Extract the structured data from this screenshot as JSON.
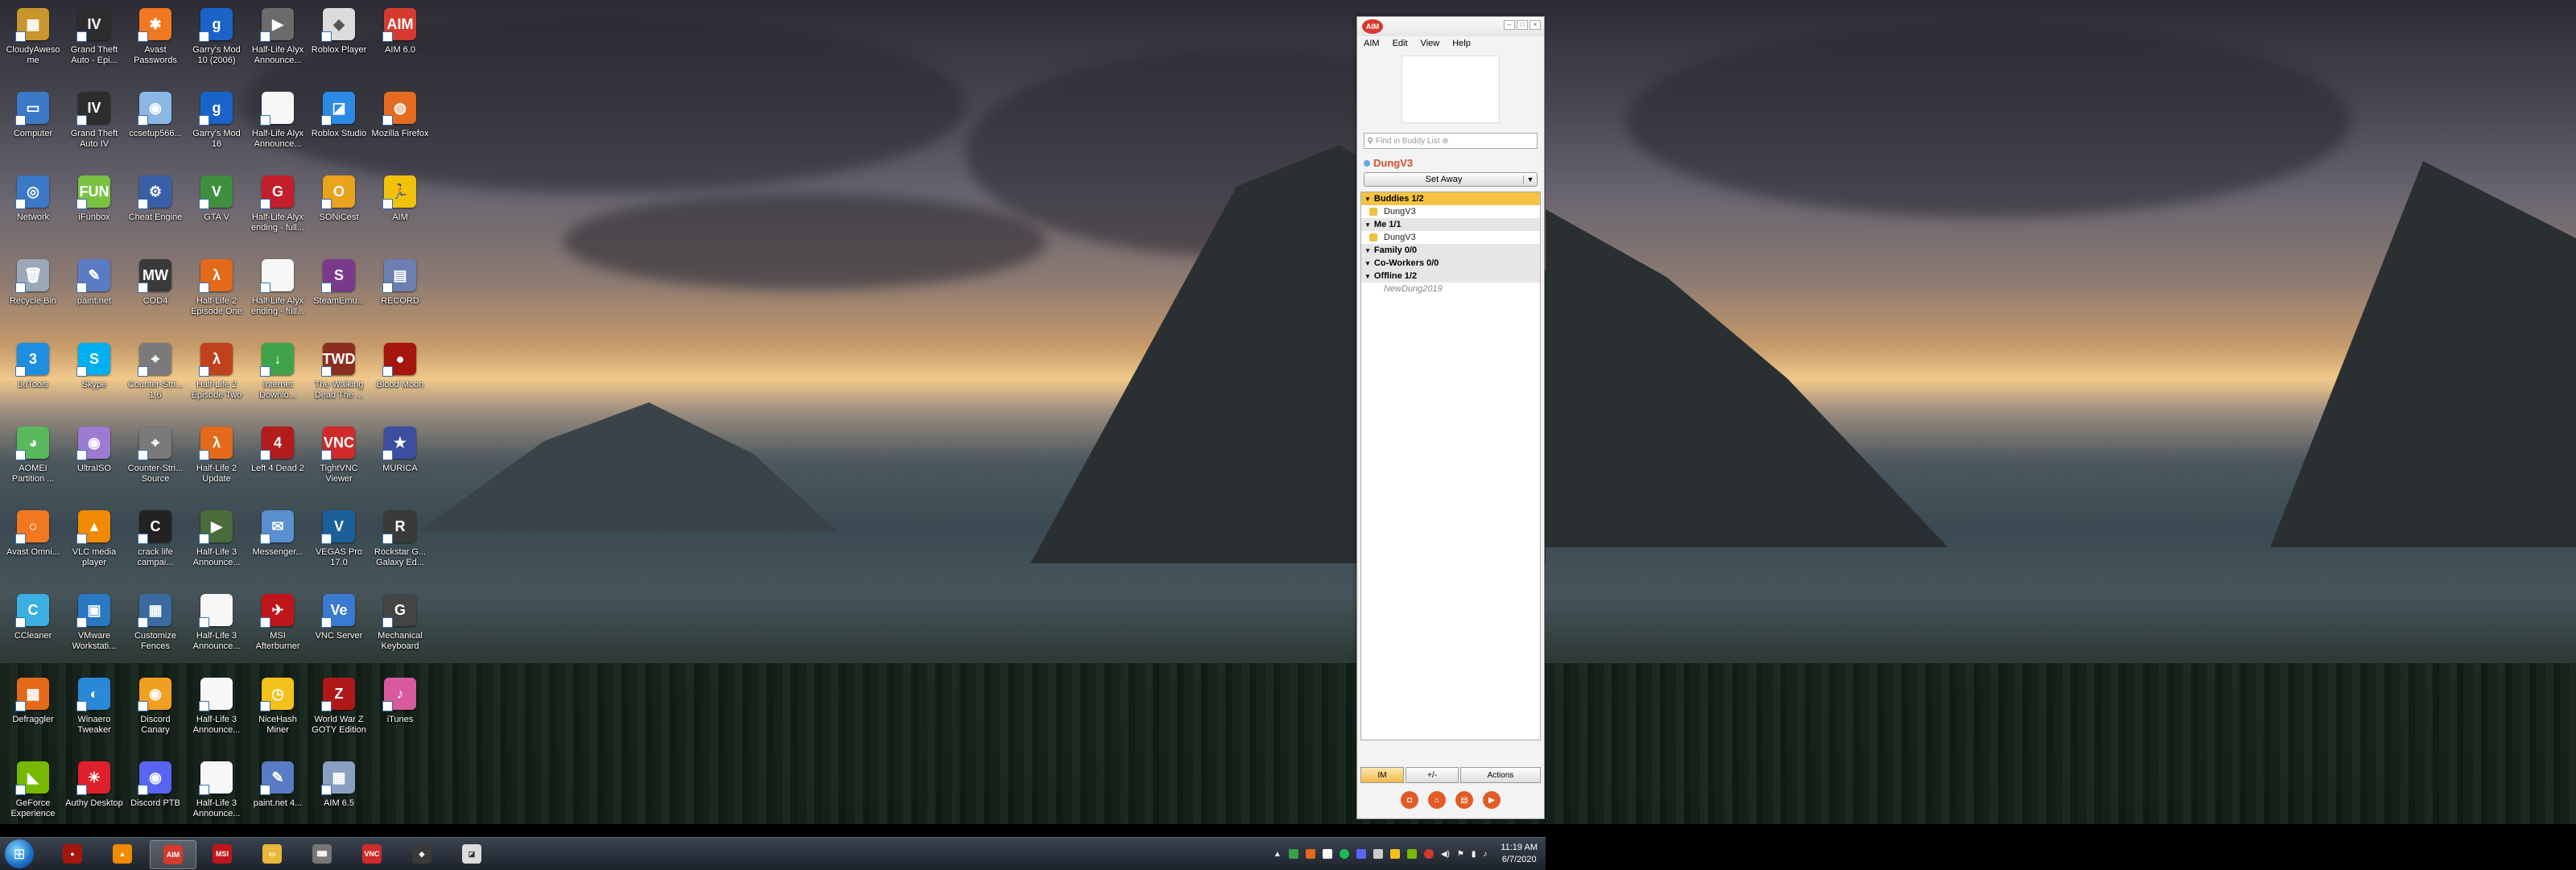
{
  "desktop_icons": [
    {
      "label": "CloudyAwesome",
      "color": "#c8962c",
      "glyph": "▦"
    },
    {
      "label": "Grand Theft Auto - Epi...",
      "color": "#2d2d2d",
      "glyph": "IV"
    },
    {
      "label": "Avast Passwords",
      "color": "#f07820",
      "glyph": "✱"
    },
    {
      "label": "Garry's Mod 10 (2006)",
      "color": "#1a63c9",
      "glyph": "g"
    },
    {
      "label": "Half-Life Alyx Announce...",
      "color": "#6b6b6b",
      "glyph": "▶"
    },
    {
      "label": "Roblox Player",
      "color": "#dcdcdc",
      "glyph": "◆"
    },
    {
      "label": "AIM 6.0",
      "color": "#d53a2e",
      "glyph": "AIM"
    },
    {
      "label": "Computer",
      "color": "#3c79c6",
      "glyph": "▭"
    },
    {
      "label": "Grand Theft Auto IV",
      "color": "#2d2d2d",
      "glyph": "IV"
    },
    {
      "label": "ccsetup566...",
      "color": "#8bb7e6",
      "glyph": "◉"
    },
    {
      "label": "Garry's Mod 16",
      "color": "#1a63c9",
      "glyph": "g"
    },
    {
      "label": "Half-Life Alyx Announce...",
      "color": "#f7f7f7",
      "glyph": ""
    },
    {
      "label": "Roblox Studio",
      "color": "#2b8ae6",
      "glyph": "◪"
    },
    {
      "label": "Mozilla Firefox",
      "color": "#e66a1f",
      "glyph": "◍"
    },
    {
      "label": "Network",
      "color": "#3c79c6",
      "glyph": "◎"
    },
    {
      "label": "iFunbox",
      "color": "#7ac143",
      "glyph": "FUN"
    },
    {
      "label": "Cheat Engine",
      "color": "#3a5fa8",
      "glyph": "⚙"
    },
    {
      "label": "GTA V",
      "color": "#3f8f3f",
      "glyph": "V"
    },
    {
      "label": "Half-Life Alyx ending - full...",
      "color": "#c21f2a",
      "glyph": "G"
    },
    {
      "label": "SONiCest",
      "color": "#e9a31c",
      "glyph": "O"
    },
    {
      "label": "AIM",
      "color": "#f0c20c",
      "glyph": "🏃"
    },
    {
      "label": "Recycle Bin",
      "color": "#9aa8b8",
      "glyph": "🗑"
    },
    {
      "label": "paint.net",
      "color": "#5a7cc4",
      "glyph": "✎"
    },
    {
      "label": "COD4",
      "color": "#3a3a3a",
      "glyph": "MW"
    },
    {
      "label": "Half-Life 2 Episode One",
      "color": "#e26a1a",
      "glyph": "λ"
    },
    {
      "label": "Half-Life Alyx ending - full...",
      "color": "#f7f7f7",
      "glyph": ""
    },
    {
      "label": "SteamEmu...",
      "color": "#7a3a8c",
      "glyph": "S"
    },
    {
      "label": "RECORD",
      "color": "#6b7fb0",
      "glyph": "▤"
    },
    {
      "label": "3uTools",
      "color": "#1e8fe0",
      "glyph": "3"
    },
    {
      "label": "Skype",
      "color": "#00aff0",
      "glyph": "S"
    },
    {
      "label": "Counter-Stri... 1.6",
      "color": "#7a7a7a",
      "glyph": "⌖"
    },
    {
      "label": "Half-Life 2 Episode Two",
      "color": "#c0421c",
      "glyph": "λ"
    },
    {
      "label": "Internet Downlo...",
      "color": "#3fa34a",
      "glyph": "↓"
    },
    {
      "label": "The Walking Dead The ...",
      "color": "#8a2f1f",
      "glyph": "TWD"
    },
    {
      "label": "Blood Moon",
      "color": "#a5160e",
      "glyph": "●"
    },
    {
      "label": "AOMEI Partition ...",
      "color": "#5ab85c",
      "glyph": "◕"
    },
    {
      "label": "UltraISO",
      "color": "#9c7bd0",
      "glyph": "◉"
    },
    {
      "label": "Counter-Stri... Source",
      "color": "#7a7a7a",
      "glyph": "⌖"
    },
    {
      "label": "Half-Life 2 Update",
      "color": "#e26a1a",
      "glyph": "λ"
    },
    {
      "label": "Left 4 Dead 2",
      "color": "#b21c1c",
      "glyph": "4"
    },
    {
      "label": "TightVNC Viewer",
      "color": "#d02a2a",
      "glyph": "VNC"
    },
    {
      "label": "MURICA",
      "color": "#3b4ea0",
      "glyph": "★"
    },
    {
      "label": "Avast Omni...",
      "color": "#f07820",
      "glyph": "○"
    },
    {
      "label": "VLC media player",
      "color": "#f08a00",
      "glyph": "▲"
    },
    {
      "label": "crack life campai...",
      "color": "#222",
      "glyph": "C"
    },
    {
      "label": "Half-Life 3 Announce...",
      "color": "#4a6b3a",
      "glyph": "▶"
    },
    {
      "label": "Messenger...",
      "color": "#5a8fd0",
      "glyph": "✉"
    },
    {
      "label": "VEGAS Pro 17.0",
      "color": "#1b5f9a",
      "glyph": "V"
    },
    {
      "label": "Rockstar G... Galaxy Ed...",
      "color": "#3a3a3a",
      "glyph": "R"
    },
    {
      "label": "CCleaner",
      "color": "#3ab0e0",
      "glyph": "C"
    },
    {
      "label": "VMware Workstati...",
      "color": "#2a78c2",
      "glyph": "▣"
    },
    {
      "label": "Customize Fences",
      "color": "#3a6aa0",
      "glyph": "▦"
    },
    {
      "label": "Half-Life 3 Announce...",
      "color": "#f7f7f7",
      "glyph": ""
    },
    {
      "label": "MSI Afterburner",
      "color": "#c0161b",
      "glyph": "✈"
    },
    {
      "label": "VNC Server",
      "color": "#3a7ad0",
      "glyph": "Ve"
    },
    {
      "label": "Mechanical Keyboard",
      "color": "#444",
      "glyph": "G"
    },
    {
      "label": "Defraggler",
      "color": "#e26a1a",
      "glyph": "▦"
    },
    {
      "label": "Winaero Tweaker",
      "color": "#2a88d8",
      "glyph": "◐"
    },
    {
      "label": "Discord Canary",
      "color": "#f0a020",
      "glyph": "◉"
    },
    {
      "label": "Half-Life 3 Announce...",
      "color": "#f7f7f7",
      "glyph": ""
    },
    {
      "label": "NiceHash Miner",
      "color": "#f2c21b",
      "glyph": "◷"
    },
    {
      "label": "World War Z GOTY Edition",
      "color": "#b01818",
      "glyph": "Z"
    },
    {
      "label": "iTunes",
      "color": "#d65a9c",
      "glyph": "♪"
    },
    {
      "label": "GeForce Experience",
      "color": "#76b900",
      "glyph": "◣"
    },
    {
      "label": "Authy Desktop",
      "color": "#e0202c",
      "glyph": "✳"
    },
    {
      "label": "Discord PTB",
      "color": "#5865f2",
      "glyph": "◉"
    },
    {
      "label": "Half-Life 3 Announce...",
      "color": "#f7f7f7",
      "glyph": ""
    },
    {
      "label": "paint.net 4...",
      "color": "#5a7cc4",
      "glyph": "✎"
    },
    {
      "label": "AIM 6.5",
      "color": "#8aa0c0",
      "glyph": "▦"
    }
  ],
  "aim": {
    "title_logo": "AIM",
    "menu": [
      "AIM",
      "Edit",
      "View",
      "Help"
    ],
    "search_placeholder": "Find in Buddy List ⊕",
    "screen_name": "DungV3",
    "status": "Set Away",
    "groups": [
      {
        "label": "Buddies 1/2",
        "selected": true,
        "buddies": [
          {
            "name": "DungV3",
            "offline": false
          }
        ]
      },
      {
        "label": "Me 1/1",
        "selected": false,
        "buddies": [
          {
            "name": "DungV3",
            "offline": false
          }
        ]
      },
      {
        "label": "Family 0/0",
        "selected": false,
        "buddies": []
      },
      {
        "label": "Co-Workers 0/0",
        "selected": false,
        "buddies": []
      },
      {
        "label": "Offline 1/2",
        "selected": false,
        "buddies": [
          {
            "name": "NewDung2019",
            "offline": true
          }
        ]
      }
    ],
    "bottom": {
      "im": "IM",
      "plusminus": "+/-",
      "actions": "Actions"
    }
  },
  "taskbar": {
    "apps": [
      {
        "name": "blood-moon",
        "color": "#a5160e",
        "glyph": "●"
      },
      {
        "name": "vlc",
        "color": "#f08a00",
        "glyph": "▲"
      },
      {
        "name": "aim",
        "color": "#d53a2e",
        "glyph": "AIM",
        "active": true
      },
      {
        "name": "msi",
        "color": "#c0161b",
        "glyph": "MSI"
      },
      {
        "name": "explorer",
        "color": "#e8b83a",
        "glyph": "▭"
      },
      {
        "name": "keyboard",
        "color": "#777",
        "glyph": "⌨"
      },
      {
        "name": "vnc",
        "color": "#d02a2a",
        "glyph": "VNC"
      },
      {
        "name": "rockstar",
        "color": "#3a3a3a",
        "glyph": "◆"
      },
      {
        "name": "roblox",
        "color": "#dcdcdc",
        "glyph": "◪"
      }
    ],
    "time": "11:19 AM",
    "date": "6/7/2020"
  }
}
